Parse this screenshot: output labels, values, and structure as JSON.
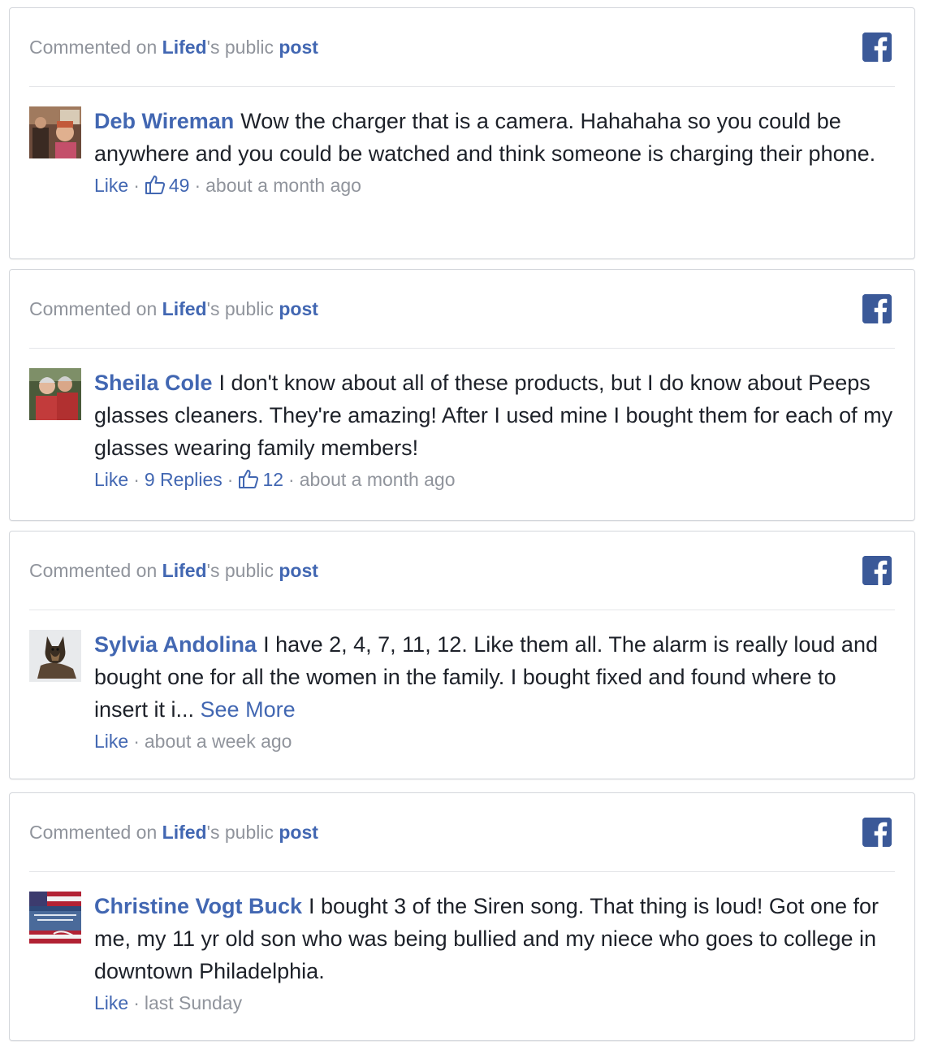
{
  "comments": [
    {
      "header": {
        "prefix": "Commented on ",
        "page": "Lifed",
        "possessive": "'s public ",
        "post": "post"
      },
      "author": "Deb Wireman",
      "text": "Wow the charger that is a camera. Hahahaha so you could be anywhere and you could be watched and think someone is charging their phone.",
      "see_more": "",
      "like_label": "Like",
      "replies": "",
      "likes": "49",
      "time": "about a month ago",
      "avatar_icon": "person-photo-icon"
    },
    {
      "header": {
        "prefix": "Commented on ",
        "page": "Lifed",
        "possessive": "'s public ",
        "post": "post"
      },
      "author": "Sheila Cole",
      "text": "I don't know about all of these products, but I do know about Peeps glasses cleaners. They're amazing! After I used mine I bought them for each of my glasses wearing family members!",
      "see_more": "",
      "like_label": "Like",
      "replies": "9 Replies",
      "likes": "12",
      "time": "about a month ago",
      "avatar_icon": "couple-photo-icon"
    },
    {
      "header": {
        "prefix": "Commented on ",
        "page": "Lifed",
        "possessive": "'s public ",
        "post": "post"
      },
      "author": "Sylvia Andolina",
      "text": "I have 2, 4, 7, 11, 12. Like them all. The alarm is really loud and bought one for all the women in the family. I bought fixed and found where to insert it i... ",
      "see_more": "See More",
      "like_label": "Like",
      "replies": "",
      "likes": "",
      "time": "about a week ago",
      "avatar_icon": "dog-photo-icon"
    },
    {
      "header": {
        "prefix": "Commented on ",
        "page": "Lifed",
        "possessive": "'s public ",
        "post": "post"
      },
      "author": "Christine Vogt Buck",
      "text": "I bought 3 of the Siren song. That thing is loud! Got one for me, my 11 yr old son who was being bullied and my niece who goes to college in downtown Philadelphia.",
      "see_more": "",
      "like_label": "Like",
      "replies": "",
      "likes": "",
      "time": "last Sunday",
      "avatar_icon": "flag-photo-icon"
    }
  ],
  "colors": {
    "link": "#4267b2",
    "muted": "#90949c",
    "text": "#1d2129",
    "facebook_blue": "#3b5998",
    "border": "#d3d6db"
  }
}
